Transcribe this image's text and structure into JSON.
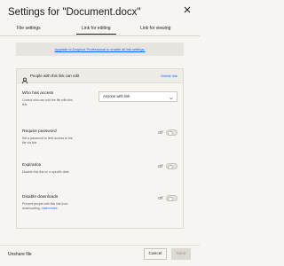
{
  "dialog": {
    "title": "Settings for \"Document.docx\""
  },
  "tabs": [
    {
      "label": "File settings",
      "active": false
    },
    {
      "label": "Link for editing",
      "active": true
    },
    {
      "label": "Link for viewing",
      "active": false
    }
  ],
  "upgrade": {
    "text": "Upgrade to Dropbox Professional to enable all link settings."
  },
  "link": {
    "header": "People with this link can edit",
    "delete_label": "Delete link"
  },
  "settings": {
    "access": {
      "label": "Who has access",
      "description": "Control who can edit the file with this link.",
      "value": "Anyone with link"
    },
    "password": {
      "label": "Require password",
      "description": "Set a password to limit access to the file via link.",
      "state_label": "Off"
    },
    "expiration": {
      "label": "Expiration",
      "description": "Disable this link on a specific date.",
      "state_label": "Off"
    },
    "downloads": {
      "label": "Disable downloads",
      "description": "Prevent people with this link from downloading.",
      "learn_more": "Learn more",
      "state_label": "Off"
    }
  },
  "footer": {
    "unshare_label": "Unshare file",
    "cancel_label": "Cancel",
    "save_label": "Save"
  },
  "colors": {
    "background": "#f7f5f2",
    "link_blue": "#0061fe",
    "text": "#1e1919"
  }
}
